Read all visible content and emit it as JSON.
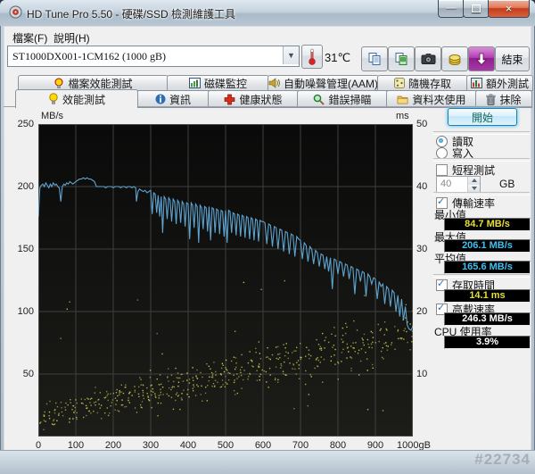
{
  "window": {
    "title": "HD Tune Pro 5.50 - 硬碟/SSD 檢測維護工具",
    "watermark": "#22734"
  },
  "menu": {
    "items": [
      "檔案(F)",
      "說明(H)"
    ]
  },
  "toolbar": {
    "drive": "ST1000DX001-1CM162 (1000 gB)",
    "temperature": "31℃",
    "exit": "結束",
    "icon_names": [
      "copy-text-icon",
      "copy-image-icon",
      "screenshot-camera-icon",
      "save-icon",
      "update-download-icon"
    ]
  },
  "tabs": {
    "row1": [
      "檔案效能測試",
      "磁碟監控",
      "自動噪聲管理(AAM)",
      "隨機存取",
      "額外測試"
    ],
    "row2": [
      "效能測試",
      "資訊",
      "健康狀態",
      "錯誤掃瞄",
      "資料夾使用",
      "抹除"
    ],
    "active": "效能測試"
  },
  "panel": {
    "start": "開始",
    "read": "讀取",
    "write": "寫入",
    "short_test": "短程測試",
    "short_test_value": "40",
    "short_test_unit": "GB",
    "transfer_rate": "傳輸速率",
    "min_label": "最小值",
    "min_value": "84.7 MB/s",
    "max_label": "最大值",
    "max_value": "206.1 MB/s",
    "avg_label": "平均值",
    "avg_value": "165.6 MB/s",
    "access_time": "存取時間",
    "access_value": "14.1 ms",
    "burst_rate": "高載速率",
    "burst_value": "246.3 MB/s",
    "cpu_label": "CPU 使用率",
    "cpu_value": "3.9%"
  },
  "colors": {
    "transfer_line": "#5ea4d0",
    "access_dot": "#c9c94f",
    "value_min": "#e6de3a",
    "value_max_avg": "#3fc0f0",
    "value_access": "#e6de3a",
    "value_white": "#ffffff",
    "chart_bg_top": "#0a0a0a",
    "chart_bg_bottom": "#1c1c18",
    "grid": "#3f3f3f",
    "start_text": "#17665a"
  },
  "chart_data": {
    "type": [
      "line",
      "scatter"
    ],
    "left_axis": {
      "label": "MB/s",
      "min": 0,
      "max": 250,
      "ticks": [
        250,
        200,
        150,
        100,
        50
      ]
    },
    "right_axis": {
      "label": "ms",
      "min": 0,
      "max": 50,
      "ticks": [
        50,
        40,
        30,
        20,
        10
      ]
    },
    "x_axis": {
      "min": 0,
      "max": 1000,
      "ticks": [
        0,
        100,
        200,
        300,
        400,
        500,
        600,
        700,
        800,
        900
      ],
      "end_label": "1000gB"
    },
    "grid": true,
    "stats": {
      "min_mbs": 84.7,
      "max_mbs": 206.1,
      "avg_mbs": 165.6,
      "access_ms": 14.1,
      "burst_mbs": 246.3,
      "cpu_pct": 3.9
    },
    "series": [
      {
        "name": "transfer_rate",
        "kind": "line",
        "unit": "MB/s",
        "axis": "left",
        "points": [
          [
            0,
            176
          ],
          [
            4,
            199
          ],
          [
            8,
            201
          ],
          [
            12,
            202
          ],
          [
            16,
            200
          ],
          [
            20,
            203
          ],
          [
            24,
            201
          ],
          [
            28,
            199
          ],
          [
            32,
            202
          ],
          [
            36,
            200
          ],
          [
            40,
            203
          ],
          [
            44,
            201
          ],
          [
            48,
            202
          ],
          [
            52,
            200
          ],
          [
            56,
            199
          ],
          [
            60,
            188
          ],
          [
            64,
            200
          ],
          [
            68,
            202
          ],
          [
            72,
            201
          ],
          [
            76,
            203
          ],
          [
            80,
            202
          ],
          [
            84,
            204
          ],
          [
            88,
            203
          ],
          [
            92,
            202
          ],
          [
            96,
            203
          ],
          [
            100,
            204
          ],
          [
            105,
            205
          ],
          [
            110,
            206
          ],
          [
            115,
            206
          ],
          [
            120,
            207
          ],
          [
            125,
            206
          ],
          [
            130,
            207
          ],
          [
            135,
            206
          ],
          [
            140,
            206
          ],
          [
            145,
            205
          ],
          [
            150,
            204
          ],
          [
            155,
            200
          ],
          [
            160,
            200
          ],
          [
            165,
            200
          ],
          [
            170,
            200
          ],
          [
            175,
            200
          ],
          [
            180,
            199
          ],
          [
            185,
            200
          ],
          [
            190,
            200
          ],
          [
            195,
            200
          ],
          [
            200,
            199
          ],
          [
            205,
            200
          ],
          [
            210,
            200
          ],
          [
            215,
            200
          ],
          [
            220,
            199
          ],
          [
            225,
            200
          ],
          [
            230,
            200
          ],
          [
            235,
            199
          ],
          [
            240,
            200
          ],
          [
            245,
            200
          ],
          [
            250,
            199
          ],
          [
            255,
            200
          ],
          [
            260,
            199
          ],
          [
            262,
            188
          ],
          [
            266,
            196
          ],
          [
            270,
            198
          ],
          [
            275,
            197
          ],
          [
            280,
            196
          ],
          [
            285,
            197
          ],
          [
            290,
            195
          ],
          [
            295,
            196
          ],
          [
            300,
            197
          ],
          [
            304,
            178
          ],
          [
            308,
            195
          ],
          [
            312,
            194
          ],
          [
            316,
            179
          ],
          [
            320,
            193
          ],
          [
            324,
            176
          ],
          [
            328,
            192
          ],
          [
            332,
            163
          ],
          [
            336,
            192
          ],
          [
            340,
            190
          ],
          [
            344,
            174
          ],
          [
            348,
            191
          ],
          [
            352,
            189
          ],
          [
            356,
            172
          ],
          [
            360,
            190
          ],
          [
            364,
            188
          ],
          [
            368,
            170
          ],
          [
            372,
            189
          ],
          [
            376,
            187
          ],
          [
            380,
            171
          ],
          [
            384,
            188
          ],
          [
            388,
            186
          ],
          [
            392,
            168
          ],
          [
            396,
            187
          ],
          [
            400,
            186
          ],
          [
            404,
            158
          ],
          [
            408,
            187
          ],
          [
            412,
            185
          ],
          [
            416,
            167
          ],
          [
            420,
            186
          ],
          [
            424,
            184
          ],
          [
            428,
            155
          ],
          [
            432,
            185
          ],
          [
            436,
            183
          ],
          [
            440,
            166
          ],
          [
            444,
            184
          ],
          [
            448,
            183
          ],
          [
            452,
            164
          ],
          [
            456,
            184
          ],
          [
            460,
            157
          ],
          [
            464,
            183
          ],
          [
            468,
            182
          ],
          [
            472,
            163
          ],
          [
            476,
            182
          ],
          [
            480,
            181
          ],
          [
            484,
            162
          ],
          [
            488,
            181
          ],
          [
            492,
            180
          ],
          [
            496,
            160
          ],
          [
            500,
            181
          ],
          [
            504,
            155
          ],
          [
            508,
            181
          ],
          [
            512,
            180
          ],
          [
            516,
            163
          ],
          [
            520,
            179
          ],
          [
            524,
            178
          ],
          [
            528,
            161
          ],
          [
            532,
            178
          ],
          [
            536,
            177
          ],
          [
            540,
            160
          ],
          [
            544,
            177
          ],
          [
            548,
            176
          ],
          [
            552,
            159
          ],
          [
            556,
            176
          ],
          [
            560,
            175
          ],
          [
            564,
            158
          ],
          [
            568,
            175
          ],
          [
            572,
            174
          ],
          [
            576,
            157
          ],
          [
            580,
            174
          ],
          [
            584,
            173
          ],
          [
            588,
            156
          ],
          [
            592,
            173
          ],
          [
            596,
            172
          ],
          [
            600,
            172
          ],
          [
            605,
            171
          ],
          [
            610,
            154
          ],
          [
            615,
            170
          ],
          [
            620,
            169
          ],
          [
            625,
            152
          ],
          [
            630,
            168
          ],
          [
            635,
            167
          ],
          [
            640,
            150
          ],
          [
            645,
            166
          ],
          [
            650,
            165
          ],
          [
            655,
            148
          ],
          [
            660,
            164
          ],
          [
            665,
            163
          ],
          [
            670,
            146
          ],
          [
            675,
            162
          ],
          [
            680,
            161
          ],
          [
            685,
            144
          ],
          [
            690,
            160
          ],
          [
            695,
            158
          ],
          [
            700,
            157
          ],
          [
            705,
            142
          ],
          [
            710,
            155
          ],
          [
            715,
            153
          ],
          [
            720,
            140
          ],
          [
            725,
            152
          ],
          [
            730,
            150
          ],
          [
            735,
            138
          ],
          [
            740,
            149
          ],
          [
            745,
            147
          ],
          [
            750,
            136
          ],
          [
            755,
            146
          ],
          [
            760,
            145
          ],
          [
            765,
            134
          ],
          [
            770,
            144
          ],
          [
            775,
            132
          ],
          [
            780,
            143
          ],
          [
            785,
            118
          ],
          [
            790,
            142
          ],
          [
            795,
            141
          ],
          [
            800,
            130
          ],
          [
            805,
            140
          ],
          [
            810,
            139
          ],
          [
            815,
            128
          ],
          [
            820,
            138
          ],
          [
            825,
            137
          ],
          [
            830,
            126
          ],
          [
            835,
            136
          ],
          [
            840,
            135
          ],
          [
            845,
            114
          ],
          [
            850,
            134
          ],
          [
            855,
            133
          ],
          [
            860,
            124
          ],
          [
            865,
            132
          ],
          [
            870,
            131
          ],
          [
            875,
            112
          ],
          [
            880,
            130
          ],
          [
            885,
            128
          ],
          [
            890,
            122
          ],
          [
            895,
            127
          ],
          [
            900,
            126
          ],
          [
            905,
            110
          ],
          [
            910,
            124
          ],
          [
            915,
            120
          ],
          [
            920,
            122
          ],
          [
            925,
            106
          ],
          [
            930,
            120
          ],
          [
            935,
            118
          ],
          [
            940,
            104
          ],
          [
            945,
            117
          ],
          [
            950,
            115
          ],
          [
            955,
            100
          ],
          [
            960,
            113
          ],
          [
            965,
            96
          ],
          [
            970,
            110
          ],
          [
            975,
            93
          ],
          [
            980,
            104
          ],
          [
            985,
            89
          ],
          [
            990,
            86
          ],
          [
            995,
            85
          ],
          [
            1000,
            88
          ]
        ]
      },
      {
        "name": "access_time",
        "kind": "scatter",
        "unit": "ms",
        "axis": "right",
        "scatter_model": {
          "count": 560,
          "seed": 1337,
          "base_start_ms": 3.5,
          "base_end_ms": 16.5,
          "spread_start": 2.2,
          "spread_end": 4.4,
          "outlier_rate": 0.05,
          "min_ms": 1.2,
          "max_ms": 27.5
        }
      }
    ]
  }
}
